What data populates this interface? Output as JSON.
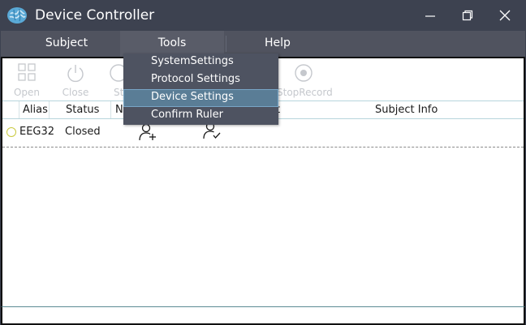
{
  "window": {
    "title": "Device Controller",
    "icons": {
      "logo": "brain-icon",
      "minimize": "minimize-icon",
      "maximize": "restore-icon",
      "close": "close-icon"
    }
  },
  "menubar": {
    "items": [
      "Subject",
      "Tools",
      "Help"
    ]
  },
  "toolbar": {
    "items": [
      {
        "label": "Open",
        "icon": "grid-icon"
      },
      {
        "label": "Close",
        "icon": "power-icon"
      },
      {
        "label": "St",
        "icon": "start-icon"
      },
      {
        "label": "StopRecord",
        "icon": "stop-record-icon"
      }
    ]
  },
  "table": {
    "columns": [
      "Alias",
      "Status",
      "N",
      "t",
      "Subject Info"
    ],
    "rows": [
      {
        "alias": "EEG32",
        "status": "Closed",
        "icons": [
          "add-user-icon",
          "confirm-user-icon"
        ]
      }
    ]
  },
  "tools_menu": {
    "items": [
      "SystemSettings",
      "Protocol Settings",
      "Device Settings",
      "Confirm Ruler"
    ],
    "highlighted": "Device Settings"
  },
  "colors": {
    "titlebar": "#3d4250",
    "menubar": "#50535f",
    "dropdown": "#4e5361",
    "highlight": "#5a7d96",
    "disabled_text": "#c5c8cd"
  }
}
